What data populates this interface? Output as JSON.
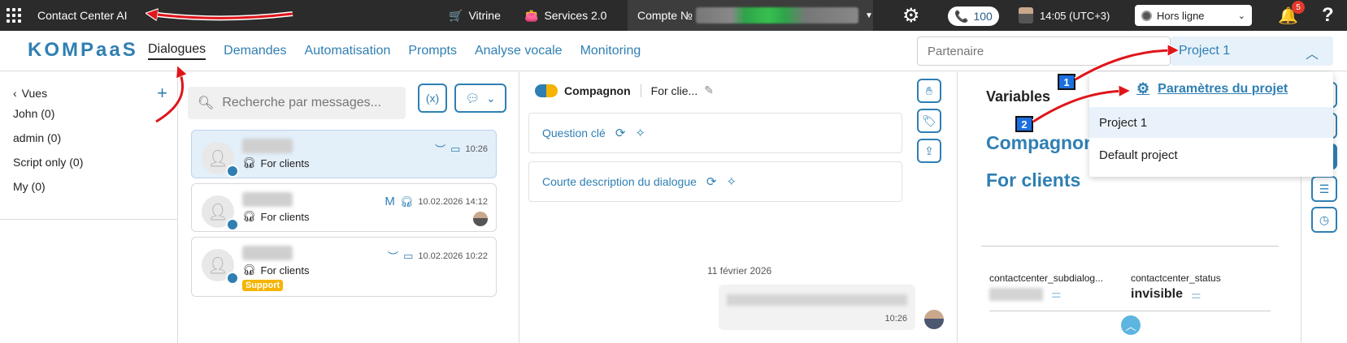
{
  "topbar": {
    "app_title": "Contact Center AI",
    "vitrine": "Vitrine",
    "services": "Services 2.0",
    "account_label": "Compte №",
    "phone_count": "100",
    "time": "14:05 (UTC+3)",
    "status": "Hors ligne",
    "notifications": "5",
    "help": "?"
  },
  "nav": {
    "logo": "KOMPaaS",
    "items": [
      "Dialogues",
      "Demandes",
      "Automatisation",
      "Prompts",
      "Analyse vocale",
      "Monitoring"
    ],
    "partner_placeholder": "Partenaire",
    "project": "Project 1"
  },
  "views": {
    "title": "Vues",
    "items": [
      "John (0)",
      "admin (0)",
      "Script only (0)",
      "My (0)"
    ]
  },
  "dialogs": {
    "search_placeholder": "Recherche par messages...",
    "cards": [
      {
        "channel": "For clients",
        "time": "10:26"
      },
      {
        "channel": "For clients",
        "time": "10.02.2026 14:12",
        "prefix": "M"
      },
      {
        "channel": "For clients",
        "time": "10.02.2026 10:22",
        "tag": "Support"
      }
    ]
  },
  "conversation": {
    "assistant": "Compagnon",
    "channel": "For clie...",
    "key_question": "Question clé",
    "short_description": "Courte description du dialogue",
    "date": "11 février 2026",
    "msg_time": "10:26"
  },
  "variables": {
    "title": "Variables",
    "assistant": "Compagnon",
    "channel": "For clients",
    "var1_name": "contactcenter_subdialog...",
    "var2_name": "contactcenter_status",
    "var2_value": "invisible"
  },
  "dropdown": {
    "settings": "Paramètres du projet",
    "options": [
      "Project 1",
      "Default project"
    ]
  },
  "markers": [
    "1",
    "2"
  ],
  "colors": {
    "accent": "#2f7fb3",
    "topbar": "#2b2b2b",
    "annotation": "#e0151a"
  }
}
